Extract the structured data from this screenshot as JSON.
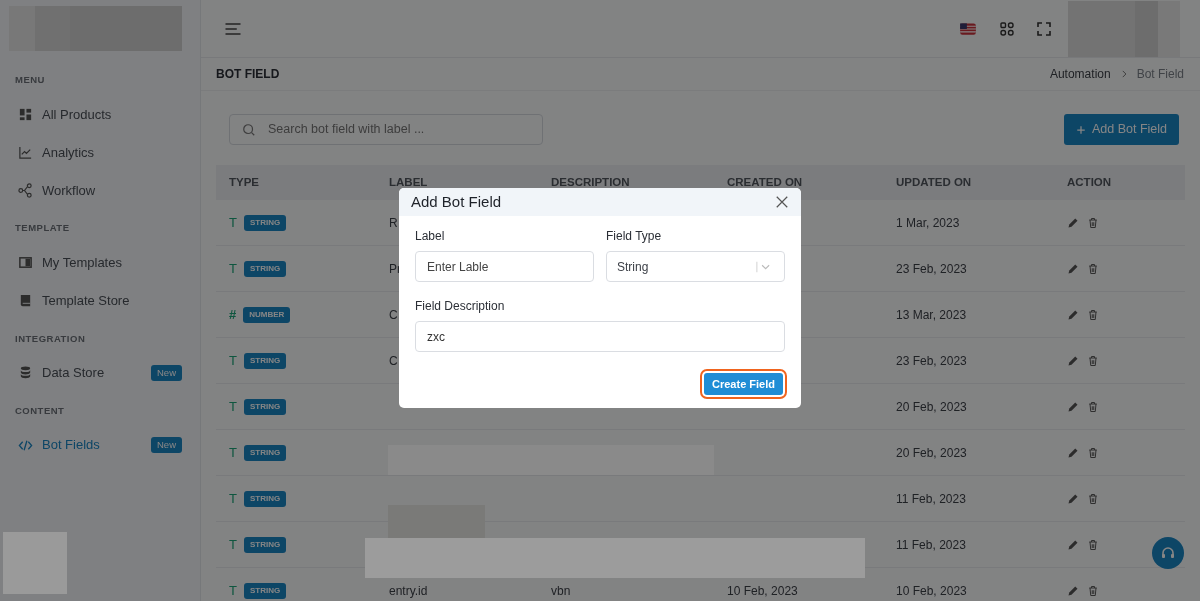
{
  "sidebar": {
    "sections": [
      {
        "title": "MENU",
        "items": [
          {
            "label": "All Products",
            "selected": false
          },
          {
            "label": "Analytics",
            "selected": false
          },
          {
            "label": "Workflow",
            "selected": false
          }
        ]
      },
      {
        "title": "TEMPLATE",
        "items": [
          {
            "label": "My Templates",
            "selected": false
          },
          {
            "label": "Template Store",
            "selected": false
          }
        ]
      },
      {
        "title": "INTEGRATION",
        "items": [
          {
            "label": "Data Store",
            "selected": false,
            "badge": "New"
          }
        ]
      },
      {
        "title": "CONTENT",
        "items": [
          {
            "label": "Bot Fields",
            "selected": true,
            "badge": "New"
          }
        ]
      }
    ]
  },
  "header": {
    "page_title": "BOT FIELD",
    "breadcrumb": [
      {
        "label": "Automation",
        "selected": false
      },
      {
        "label": "Bot Field",
        "selected": true
      }
    ]
  },
  "search": {
    "placeholder": "Search bot field with label ..."
  },
  "add_button": {
    "label": "Add Bot Field"
  },
  "table": {
    "columns": [
      "TYPE",
      "LABEL",
      "DESCRIPTION",
      "CREATED ON",
      "UPDATED ON",
      "ACTION"
    ],
    "rows": [
      {
        "kind": "string",
        "symbol": "T",
        "type": "STRING",
        "label": "R",
        "updated_on": "1 Mar, 2023"
      },
      {
        "kind": "string",
        "symbol": "T",
        "type": "STRING",
        "label": "Pr",
        "updated_on": "23 Feb, 2023"
      },
      {
        "kind": "number",
        "symbol": "#",
        "type": "NUMBER",
        "label": "C",
        "updated_on": "13 Mar, 2023"
      },
      {
        "kind": "string",
        "symbol": "T",
        "type": "STRING",
        "label": "C",
        "updated_on": "23 Feb, 2023"
      },
      {
        "kind": "string",
        "symbol": "T",
        "type": "STRING",
        "updated_on": "20 Feb, 2023"
      },
      {
        "kind": "string",
        "symbol": "T",
        "type": "STRING",
        "updated_on": "20 Feb, 2023"
      },
      {
        "kind": "string",
        "symbol": "T",
        "type": "STRING",
        "updated_on": "11 Feb, 2023"
      },
      {
        "kind": "string",
        "symbol": "T",
        "type": "STRING",
        "updated_on": "11 Feb, 2023"
      },
      {
        "kind": "string",
        "symbol": "T",
        "type": "STRING",
        "label": "entry.id",
        "description": "vbn",
        "created_on": "10 Feb, 2023",
        "updated_on": "10 Feb, 2023"
      }
    ]
  },
  "modal": {
    "title": "Add Bot Field",
    "fields": [
      {
        "kind": "text",
        "label": "Label",
        "placeholder": "Enter Lable"
      },
      {
        "kind": "select",
        "label": "Field Type",
        "value": "String"
      },
      {
        "kind": "text",
        "label": "Field Description",
        "value": "zxc"
      }
    ],
    "submit": {
      "label": "Create Field",
      "focused": true
    }
  }
}
